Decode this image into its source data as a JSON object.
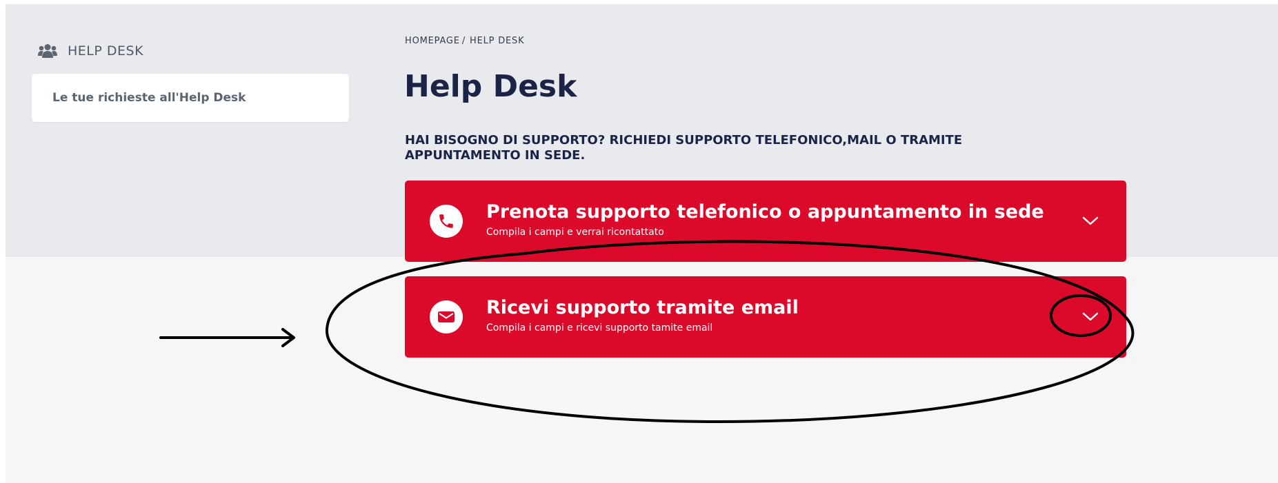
{
  "sidebar": {
    "heading": "HELP DESK",
    "heading_icon": "users-icon",
    "items": [
      {
        "label": "Le tue richieste all'Help Desk"
      }
    ]
  },
  "breadcrumb": {
    "home": "HOMEPAGE",
    "separator": "/",
    "current": "HELP DESK"
  },
  "main": {
    "title": "Help Desk",
    "support_question": "HAI BISOGNO DI SUPPORTO? RICHIEDI SUPPORTO TELEFONICO,MAIL O TRAMITE APPUNTAMENTO IN SEDE.",
    "panels": [
      {
        "icon": "phone-icon",
        "title": "Prenota supporto telefonico o appuntamento in sede",
        "subtitle": "Compila i campi e verrai ricontattato",
        "chevron_icon": "chevron-down-icon"
      },
      {
        "icon": "envelope-icon",
        "title": "Ricevi supporto tramite email",
        "subtitle": "Compila i campi e ricevi supporto tamite email",
        "chevron_icon": "chevron-down-icon"
      }
    ]
  },
  "colors": {
    "accent_red": "#dc0a2a",
    "title_navy": "#1b2447",
    "top_band": "#e9eaed",
    "page_background": "#f6f6f6",
    "annotation_ink": "#000000"
  }
}
